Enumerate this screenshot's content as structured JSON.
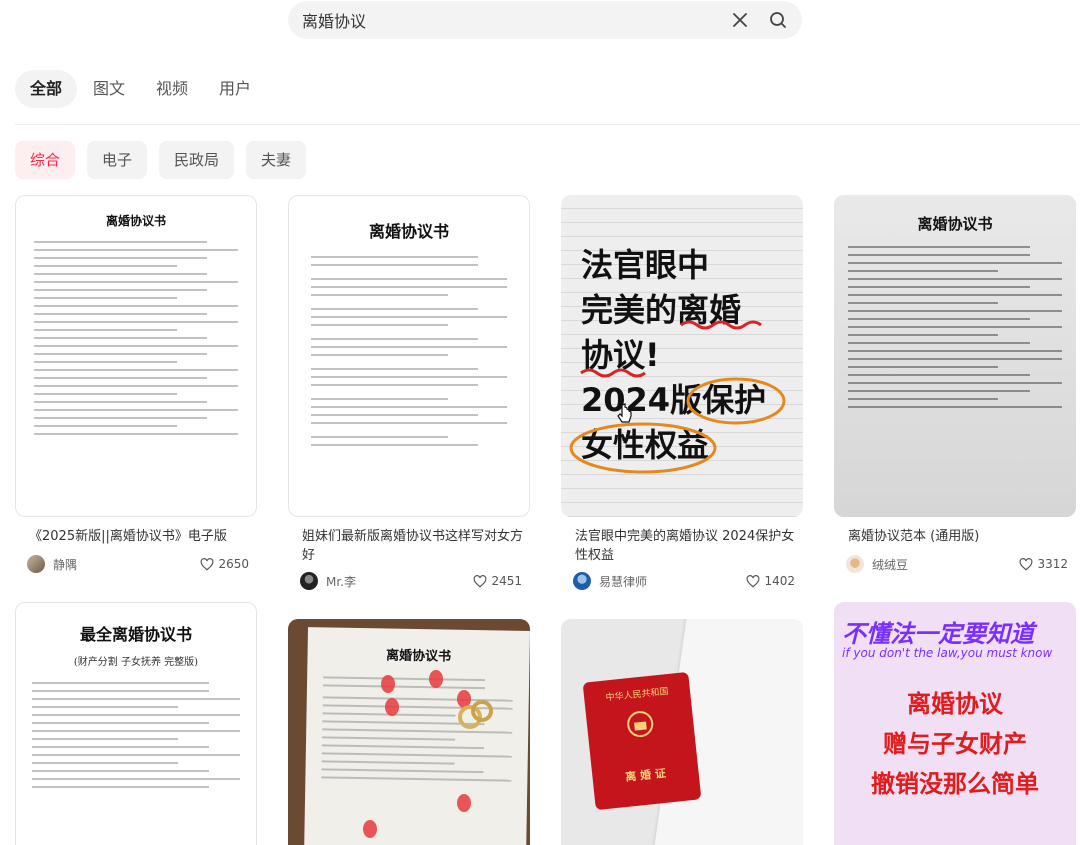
{
  "search": {
    "value": "离婚协议"
  },
  "tabs": [
    "全部",
    "图文",
    "视频",
    "用户"
  ],
  "chips": [
    "综合",
    "电子",
    "民政局",
    "夫妻"
  ],
  "colors": {
    "accent": "#ff2442",
    "chip_active_bg": "#fdeef0",
    "neutral_bg": "#f3f3f3"
  },
  "cards": [
    {
      "title": "《2025新版||离婚协议书》电子版",
      "author": "静隅",
      "likes": "2650",
      "thumb_title": "离婚协议书"
    },
    {
      "title": "姐妹们最新版离婚协议书这样写对女方好",
      "author": "Mr.李",
      "likes": "2451",
      "thumb_title": "离婚协议书"
    },
    {
      "title": "法官眼中完美的离婚协议 2024保护女性权益",
      "author": "易慧律师",
      "likes": "1402",
      "poster_lines": [
        "法官眼中",
        "完美的离婚",
        "协议!",
        "2024版保护",
        "女性权益"
      ]
    },
    {
      "title": "离婚协议范本 (通用版)",
      "author": "绒绒豆",
      "likes": "3312",
      "thumb_title": "离婚协议书"
    },
    {
      "thumb_title": "最全离婚协议书",
      "thumb_sub": "(财产分割 子女抚养 完整版)"
    },
    {
      "thumb_title": "离婚协议书"
    },
    {
      "passport_label_top": "中华人民共和国",
      "passport_label_bottom": "离 婚 证"
    },
    {
      "top_text": "不懂法一定要知道",
      "top_sub": "if you don't the law,you must know",
      "main_lines": [
        "离婚协议",
        "赠与子女财产",
        "撤销没那么简单"
      ]
    }
  ]
}
